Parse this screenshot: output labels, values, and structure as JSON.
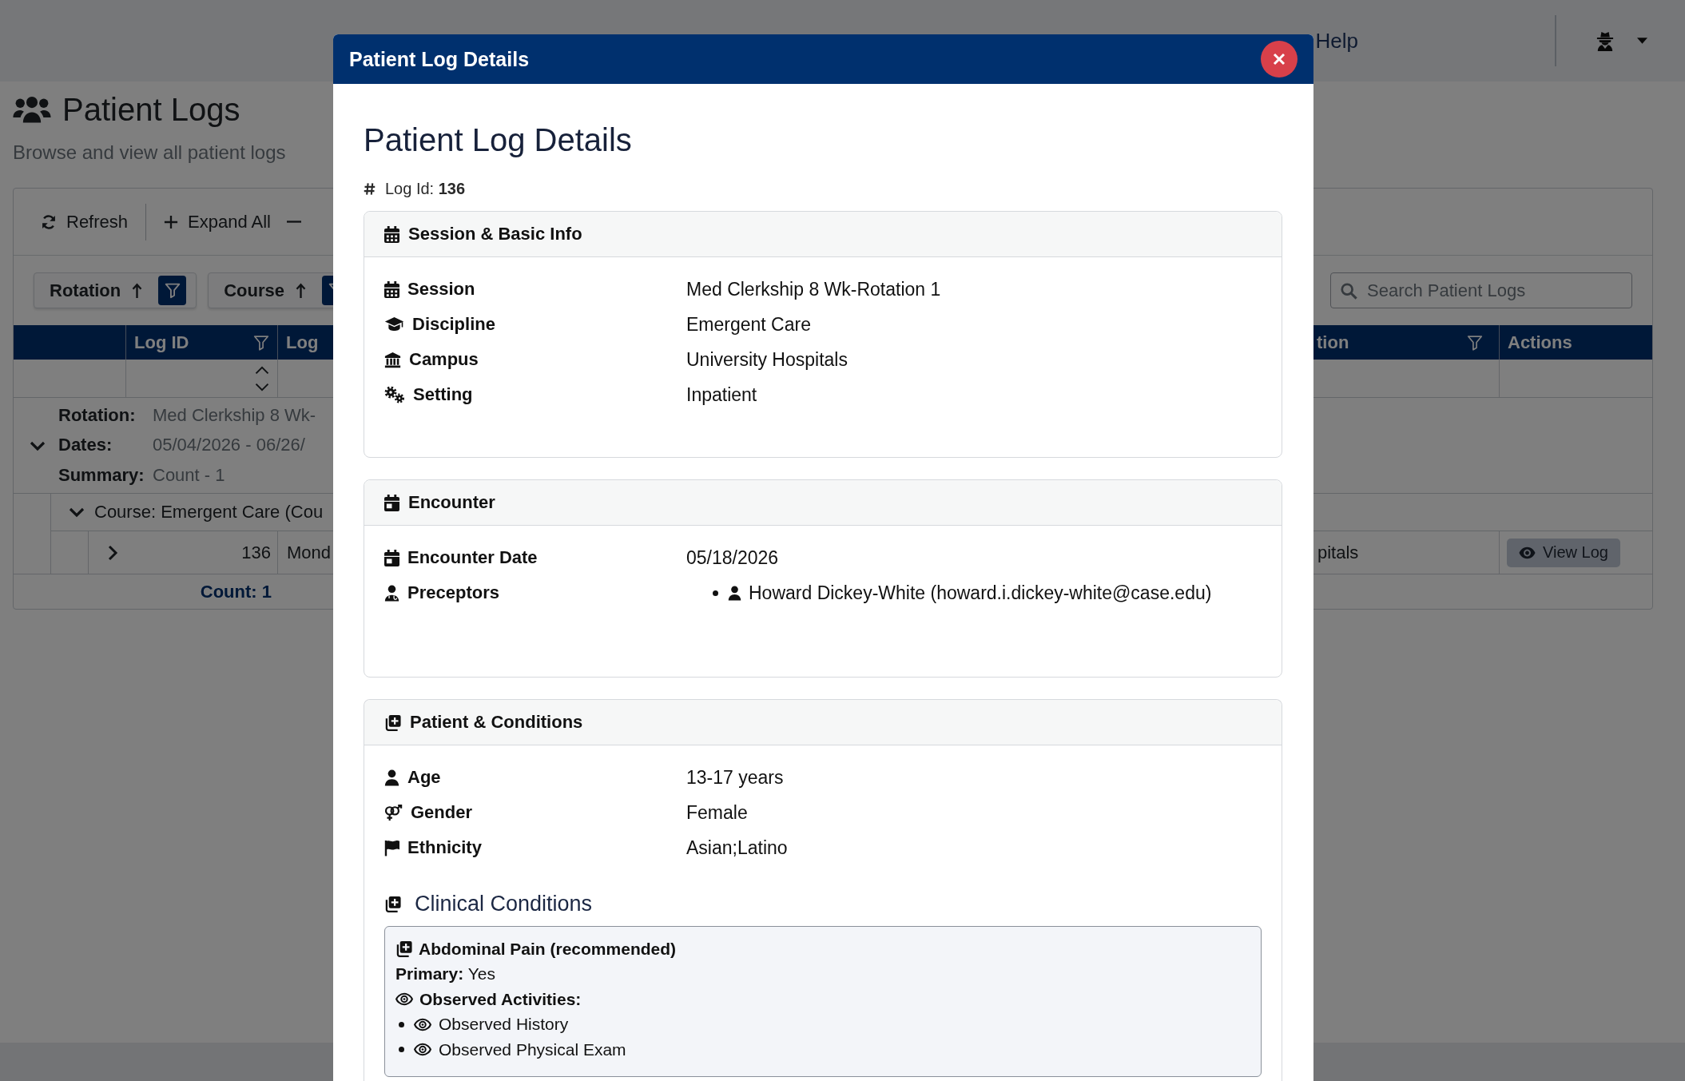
{
  "top_nav": {
    "links": [
      {
        "label": "Help"
      }
    ]
  },
  "page": {
    "title": "Patient Logs",
    "subtitle": "Browse and view all patient logs"
  },
  "toolbar": {
    "buttons": [
      {
        "kind": "refresh",
        "label": "Refresh"
      },
      {
        "kind": "plus",
        "label": "Expand All"
      },
      {
        "kind": "minus"
      }
    ]
  },
  "group_by": [
    {
      "label": "Rotation"
    },
    {
      "label": "Course"
    }
  ],
  "search": {
    "placeholder": "Search Patient Logs"
  },
  "table": {
    "columns": [
      {
        "label": "Log ID",
        "filter": true
      },
      {
        "label": "Log",
        "filter": false
      },
      {
        "label": "tion",
        "filter": true
      },
      {
        "label": "Actions",
        "filter": false
      }
    ],
    "group": {
      "expanded": true,
      "fields": [
        {
          "label": "Rotation:",
          "value": "Med Clerkship 8 Wk-"
        },
        {
          "label": "Dates:",
          "value": "05/04/2026 - 06/26/"
        },
        {
          "label": "Summary:",
          "value": "Count - 1"
        }
      ],
      "subgroup": {
        "expanded": true,
        "label": "Course: Emergent Care (Cou",
        "rows": [
          {
            "expanded": false,
            "cells": [
              "136",
              "Mond",
              "pitals"
            ],
            "action": "View Log"
          }
        ]
      }
    },
    "footer": {
      "count": "Count: 1"
    }
  },
  "modal": {
    "title": "Patient Log Details",
    "heading": "Patient Log Details",
    "log_id": "Log Id: **136**",
    "sections": [
      {
        "title": "Session & Basic Info",
        "fields": [
          {
            "kind": "text",
            "label": "Session",
            "value": "Med Clerkship 8 Wk-Rotation 1"
          },
          {
            "kind": "text",
            "label": "Discipline",
            "value": "Emergent Care"
          },
          {
            "kind": "text",
            "label": "Campus",
            "value": "University Hospitals"
          },
          {
            "kind": "text",
            "label": "Setting",
            "value": "Inpatient"
          }
        ]
      },
      {
        "title": "Encounter",
        "fields": [
          {
            "kind": "text",
            "label": "Encounter Date",
            "value": "05/18/2026"
          },
          {
            "kind": "list",
            "label": "Preceptors",
            "items": [
              "Howard Dickey-White (howard.i.dickey-white@case.edu)"
            ]
          }
        ]
      },
      {
        "title": "Patient & Conditions",
        "fields": [
          {
            "kind": "text",
            "label": "Age",
            "value": "13-17 years"
          },
          {
            "kind": "text",
            "label": "Gender",
            "value": "Female"
          },
          {
            "kind": "text",
            "label": "Ethnicity",
            "value": "Asian;Latino"
          }
        ],
        "clinical_conditions": {
          "title": "Clinical Conditions",
          "items": [
            {
              "name": "Abdominal Pain (recommended)",
              "primary": "**Primary:** Yes",
              "activities_label": "Observed Activities:",
              "activities": [
                "Observed History",
                "Observed Physical Exam"
              ]
            }
          ]
        }
      }
    ]
  }
}
